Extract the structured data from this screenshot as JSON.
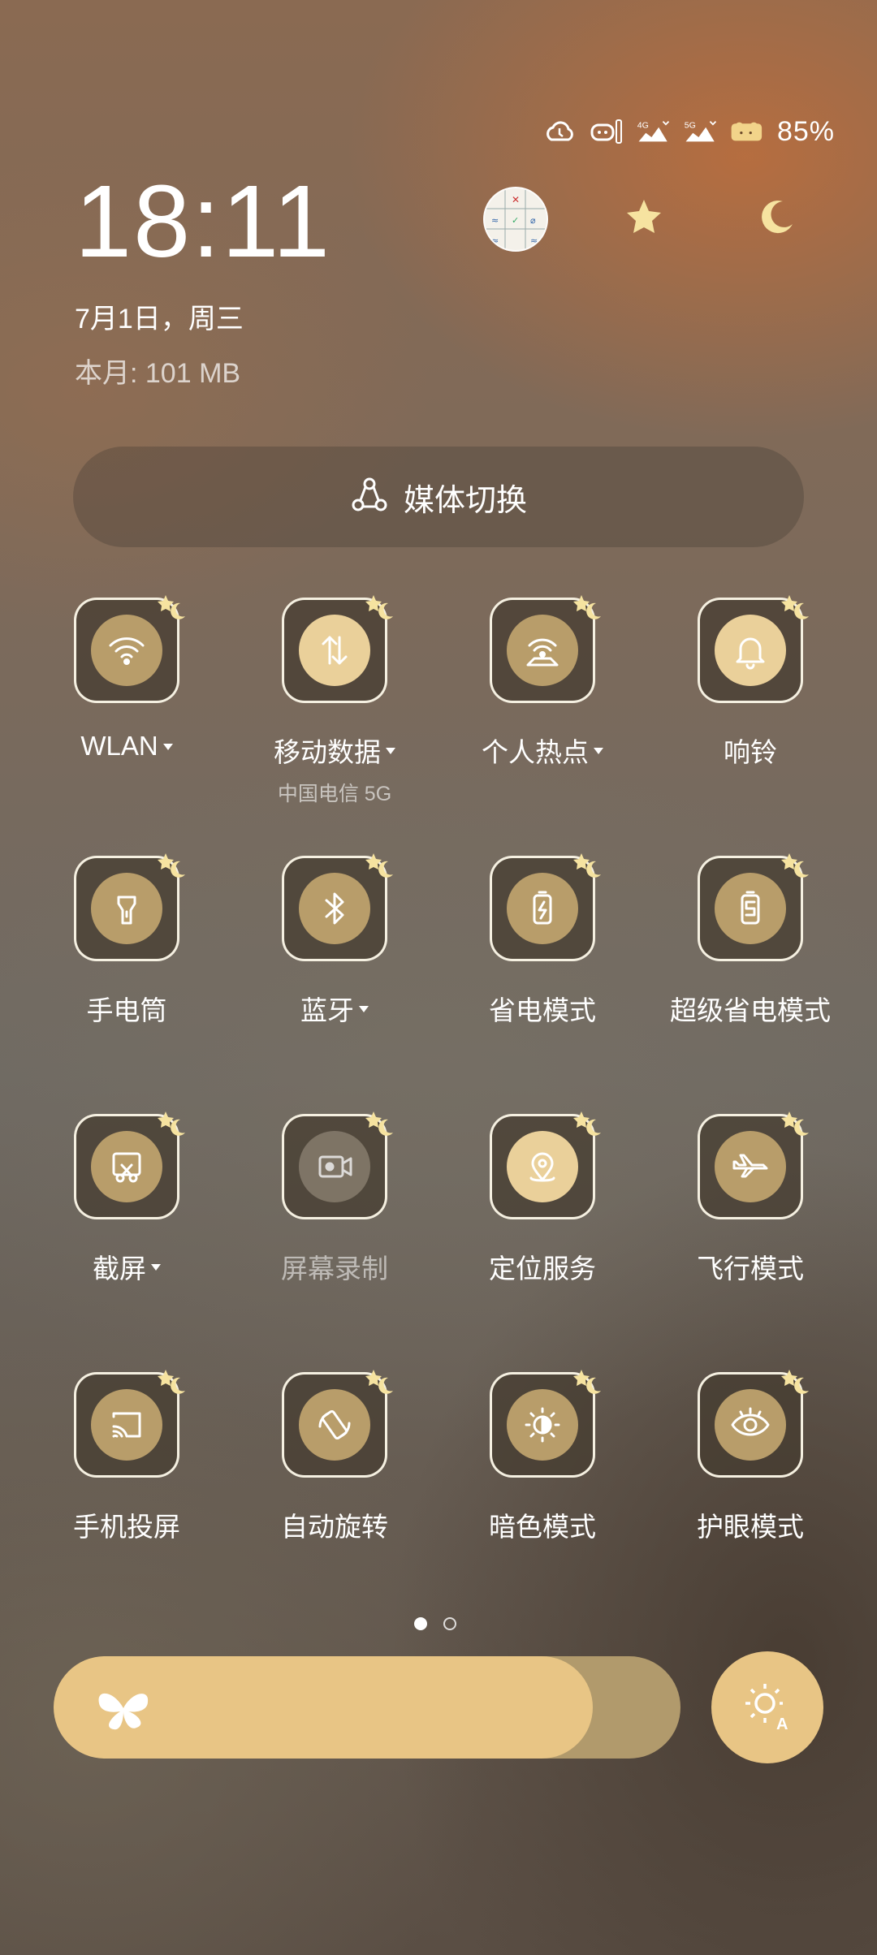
{
  "status_bar": {
    "battery": "85%"
  },
  "clock": {
    "time": "18:11",
    "date": "7月1日，周三",
    "usage": "本月: 101 MB"
  },
  "media": {
    "label": "媒体切换"
  },
  "tiles": [
    {
      "label": "WLAN",
      "sub": "",
      "icon": "wifi-icon",
      "state": "active"
    },
    {
      "label": "移动数据",
      "sub": "中国电信 5G",
      "icon": "mobile-data-icon",
      "state": "on"
    },
    {
      "label": "个人热点",
      "sub": "",
      "icon": "hotspot-icon",
      "state": "active"
    },
    {
      "label": "响铃",
      "sub": "",
      "icon": "bell-icon",
      "state": "on"
    },
    {
      "label": "手电筒",
      "sub": "",
      "icon": "flashlight-icon",
      "state": "active"
    },
    {
      "label": "蓝牙",
      "sub": "",
      "icon": "bluetooth-icon",
      "state": "active"
    },
    {
      "label": "省电模式",
      "sub": "",
      "icon": "battery-saver-icon",
      "state": "active"
    },
    {
      "label": "超级省电模式",
      "sub": "",
      "icon": "super-saver-icon",
      "state": "active"
    },
    {
      "label": "截屏",
      "sub": "",
      "icon": "screenshot-icon",
      "state": "active"
    },
    {
      "label": "屏幕录制",
      "sub": "",
      "icon": "screen-record-icon",
      "state": "disabled"
    },
    {
      "label": "定位服务",
      "sub": "",
      "icon": "location-icon",
      "state": "on"
    },
    {
      "label": "飞行模式",
      "sub": "",
      "icon": "airplane-icon",
      "state": "active"
    },
    {
      "label": "手机投屏",
      "sub": "",
      "icon": "cast-icon",
      "state": "active"
    },
    {
      "label": "自动旋转",
      "sub": "",
      "icon": "auto-rotate-icon",
      "state": "active"
    },
    {
      "label": "暗色模式",
      "sub": "",
      "icon": "dark-mode-icon",
      "state": "active"
    },
    {
      "label": "护眼模式",
      "sub": "",
      "icon": "eye-care-icon",
      "state": "active"
    }
  ],
  "pager": {
    "pages": 2,
    "current": 1
  },
  "brightness": {
    "level": 0.86
  },
  "colors": {
    "accent": "#e8c585",
    "tile_icon_bg": "#b89d6a"
  }
}
